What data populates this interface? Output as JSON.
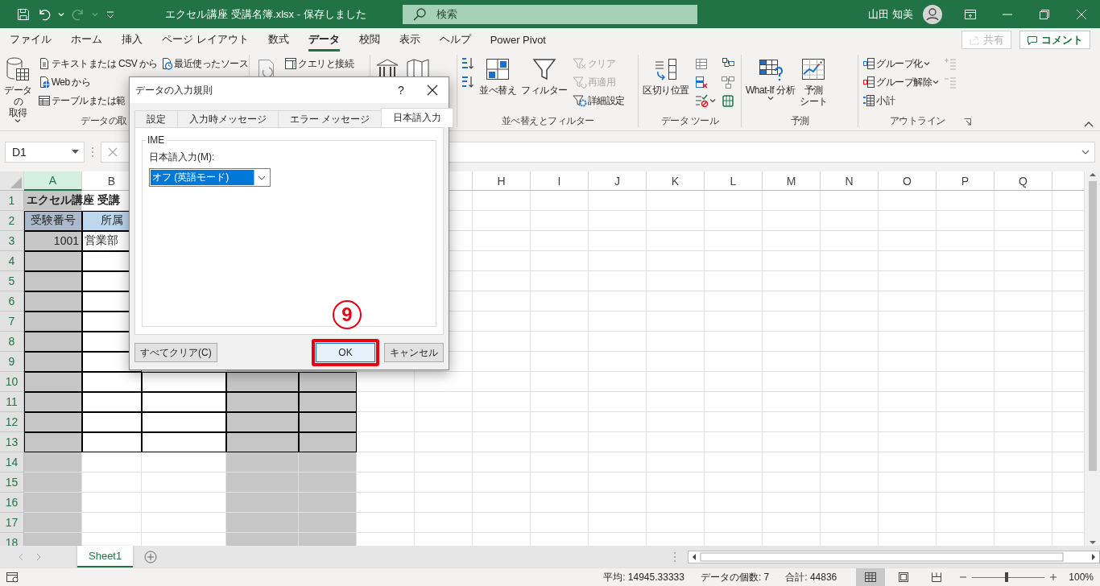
{
  "title_bar": {
    "title": "エクセル講座 受講名簿.xlsx - 保存しました",
    "search": {
      "placeholder": "検索"
    },
    "user": "山田 知美"
  },
  "ribbon_tabs": [
    {
      "label": "ファイル",
      "selected": false
    },
    {
      "label": "ホーム",
      "selected": false
    },
    {
      "label": "挿入",
      "selected": false
    },
    {
      "label": "ページ レイアウト",
      "selected": false
    },
    {
      "label": "数式",
      "selected": false
    },
    {
      "label": "データ",
      "selected": true
    },
    {
      "label": "校閲",
      "selected": false
    },
    {
      "label": "表示",
      "selected": false
    },
    {
      "label": "ヘルプ",
      "selected": false
    },
    {
      "label": "Power Pivot",
      "selected": false
    }
  ],
  "share_button": {
    "label": "共有",
    "disabled": true
  },
  "comment_button": {
    "label": "コメント"
  },
  "ribbon": {
    "groups": [
      {
        "label": "データの取",
        "columns": [
          [
            {
              "kind": "large",
              "lines": [
                "データの",
                "取得"
              ],
              "dropdown": true,
              "disabled": false
            }
          ],
          [
            {
              "kind": "small",
              "label": "テキストまたは CSV から",
              "dropdown": false,
              "disabled": false
            },
            {
              "kind": "small",
              "label": "Web から",
              "dropdown": false,
              "disabled": false
            },
            {
              "kind": "small",
              "label": "テーブルまたは範",
              "dropdown": false,
              "disabled": false
            }
          ],
          [
            {
              "kind": "small",
              "label": "最近使ったソース",
              "dropdown": false,
              "disabled": false
            }
          ]
        ]
      },
      {
        "columns": [
          [
            {
              "kind": "large",
              "dropdown": false,
              "disabled": false
            }
          ],
          [
            {
              "kind": "small",
              "label": "クエリと接続",
              "dropdown": false,
              "disabled": false
            }
          ]
        ]
      },
      {
        "columns": [
          [
            {
              "kind": "large",
              "dropdown": false,
              "disabled": false
            }
          ],
          [
            {
              "kind": "large",
              "dropdown": false,
              "disabled": false
            }
          ]
        ]
      },
      {
        "label": "並べ替えとフィルター",
        "columns": [
          [
            {
              "kind": "small",
              "dropdown": false,
              "disabled": false
            },
            {
              "kind": "small",
              "dropdown": false,
              "disabled": false
            }
          ],
          [
            {
              "kind": "large",
              "lines": [
                "並べ替え"
              ],
              "dropdown": false,
              "disabled": false
            }
          ],
          [
            {
              "kind": "large",
              "lines": [
                "フィルター"
              ],
              "dropdown": false,
              "disabled": false
            }
          ],
          [
            {
              "kind": "small",
              "label": "クリア",
              "dropdown": false,
              "disabled": true
            },
            {
              "kind": "small",
              "label": "再適用",
              "dropdown": false,
              "disabled": true
            },
            {
              "kind": "small",
              "label": "詳細設定",
              "dropdown": false,
              "disabled": false
            }
          ]
        ]
      },
      {
        "label": "データ ツール",
        "columns": [
          [
            {
              "kind": "large",
              "lines": [
                "区切り位置"
              ],
              "dropdown": false,
              "disabled": false
            }
          ],
          [
            {
              "kind": "small",
              "dropdown": false,
              "disabled": false
            },
            {
              "kind": "small",
              "dropdown": false,
              "disabled": false
            },
            {
              "kind": "small",
              "dropdown": true,
              "disabled": false
            }
          ],
          [
            {
              "kind": "small",
              "dropdown": false,
              "disabled": false
            },
            {
              "kind": "small",
              "dropdown": false,
              "disabled": false
            },
            {
              "kind": "small",
              "dropdown": false,
              "disabled": false
            }
          ]
        ]
      },
      {
        "label": "予測",
        "columns": [
          [
            {
              "kind": "large",
              "lines": [
                "What-If 分析"
              ],
              "dropdown": true,
              "disabled": false
            }
          ],
          [
            {
              "kind": "large",
              "lines": [
                "予測",
                "シート"
              ],
              "dropdown": false,
              "disabled": false
            }
          ]
        ]
      },
      {
        "label": "アウトライン",
        "launcher": true,
        "columns": [
          [
            {
              "kind": "small",
              "label": "グループ化",
              "dropdown": true,
              "disabled": false
            },
            {
              "kind": "small",
              "label": "グループ解除",
              "dropdown": true,
              "disabled": false
            },
            {
              "kind": "small",
              "label": "小計",
              "dropdown": false,
              "disabled": false
            }
          ],
          [
            {
              "kind": "small",
              "dropdown": false,
              "disabled": true
            },
            {
              "kind": "small",
              "dropdown": false,
              "disabled": true
            }
          ]
        ]
      }
    ]
  },
  "formula_bar": {
    "name_box": "D1"
  },
  "sheet": {
    "columns": [
      {
        "label": "A",
        "selected": true
      },
      {
        "label": "B",
        "selected": false
      },
      {
        "selected": false
      },
      {
        "selected": true
      },
      {
        "selected": true
      },
      {
        "selected": false
      },
      {
        "selected": false
      },
      {
        "label": "H",
        "selected": false
      },
      {
        "label": "I",
        "selected": false
      },
      {
        "label": "J",
        "selected": false
      },
      {
        "label": "K",
        "selected": false
      },
      {
        "label": "L",
        "selected": false
      },
      {
        "label": "M",
        "selected": false
      },
      {
        "label": "N",
        "selected": false
      },
      {
        "label": "O",
        "selected": false
      },
      {
        "label": "P",
        "selected": false
      },
      {
        "label": "Q",
        "selected": false
      },
      {
        "selected": false
      }
    ],
    "rows": [
      {
        "number": "1",
        "cells": [
          {
            "kind": "text",
            "text": "エクセル講座 受講",
            "bold": true,
            "bordered": false
          }
        ]
      },
      {
        "number": "2",
        "cells": [
          {
            "kind": "header",
            "text": "受験番号",
            "bold": false,
            "bordered": true
          },
          {
            "kind": "header",
            "text": "所属",
            "bold": false,
            "bordered": true
          }
        ]
      },
      {
        "number": "3",
        "cells": [
          {
            "kind": "number",
            "text": "1001",
            "bold": false,
            "bordered": true
          },
          {
            "kind": "text",
            "text": "営業部",
            "bold": false,
            "bordered": true
          }
        ]
      },
      {
        "number": "4",
        "cells": [
          {
            "kind": "empty",
            "bordered": true
          },
          {
            "kind": "empty",
            "bordered": true
          }
        ]
      },
      {
        "number": "5",
        "cells": [
          {
            "kind": "empty",
            "bordered": true
          },
          {
            "kind": "empty",
            "bordered": true
          }
        ]
      },
      {
        "number": "6",
        "cells": [
          {
            "kind": "empty",
            "bordered": true
          },
          {
            "kind": "empty",
            "bordered": true
          }
        ]
      },
      {
        "number": "7",
        "cells": [
          {
            "kind": "empty",
            "bordered": true
          },
          {
            "kind": "empty",
            "bordered": true
          }
        ]
      },
      {
        "number": "8",
        "cells": [
          {
            "kind": "empty",
            "bordered": true
          },
          {
            "kind": "empty",
            "bordered": true
          }
        ]
      },
      {
        "number": "9",
        "cells": [
          {
            "kind": "empty",
            "bordered": true
          },
          {
            "kind": "empty",
            "bordered": true
          }
        ]
      },
      {
        "number": "10",
        "cells": [
          {
            "kind": "empty",
            "bordered": true
          },
          {
            "kind": "empty",
            "bordered": true
          },
          {
            "kind": "empty",
            "bordered": true
          },
          {
            "kind": "empty",
            "bordered": true
          },
          {
            "kind": "empty",
            "bordered": true
          }
        ]
      },
      {
        "number": "11",
        "cells": [
          {
            "kind": "empty",
            "bordered": true
          },
          {
            "kind": "empty",
            "bordered": true
          },
          {
            "kind": "empty",
            "bordered": true
          },
          {
            "kind": "empty",
            "bordered": true
          },
          {
            "kind": "empty",
            "bordered": true
          }
        ]
      },
      {
        "number": "12",
        "cells": [
          {
            "kind": "empty",
            "bordered": true
          },
          {
            "kind": "empty",
            "bordered": true
          },
          {
            "kind": "empty",
            "bordered": true
          },
          {
            "kind": "empty",
            "bordered": true
          },
          {
            "kind": "empty",
            "bordered": true
          }
        ]
      },
      {
        "number": "13",
        "cells": [
          {
            "kind": "empty",
            "bordered": true
          },
          {
            "kind": "empty",
            "bordered": true
          },
          {
            "kind": "empty",
            "bordered": true
          },
          {
            "kind": "empty",
            "bordered": true
          },
          {
            "kind": "empty",
            "bordered": true
          }
        ]
      },
      {
        "number": "14"
      },
      {
        "number": "15"
      },
      {
        "number": "16"
      },
      {
        "number": "17"
      },
      {
        "number": "18"
      }
    ]
  },
  "dialog": {
    "title": "データの入力規則",
    "help": "?",
    "tabs": [
      {
        "label": "設定",
        "selected": false
      },
      {
        "label": "入力時メッセージ",
        "selected": false
      },
      {
        "label": "エラー メッセージ",
        "selected": false
      },
      {
        "label": "日本語入力",
        "selected": true
      }
    ],
    "group": "IME",
    "field_label": "日本語入力(M):",
    "value": "オフ (英語モード)",
    "buttons": [
      {
        "label": "すべてクリア(C)",
        "default": false,
        "highlighted": false
      },
      {
        "label": "OK",
        "default": true,
        "highlighted": true
      },
      {
        "label": "キャンセル",
        "default": false,
        "highlighted": false
      }
    ],
    "step_marker": "9"
  },
  "sheet_tabs": [
    {
      "label": "Sheet1",
      "selected": true
    }
  ],
  "status_bar": {
    "stats": [
      "平均: 14945.33333",
      "データの個数: 7",
      "合計: 44836"
    ],
    "views": [
      {
        "selected": true
      },
      {
        "selected": false
      },
      {
        "selected": false
      }
    ],
    "zoom": {
      "level": 0.48,
      "reading": "100%"
    }
  }
}
